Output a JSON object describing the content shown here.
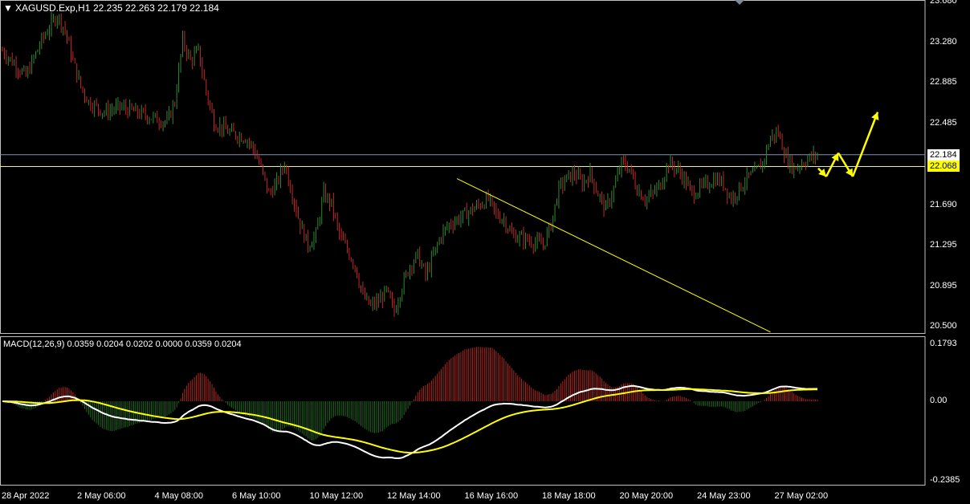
{
  "header": {
    "symbol": "XAGUSD.Exp,H1",
    "ohlc": "22.235 22.263 22.179 22.184",
    "macd_label": "MACD(12,26,9) 0.0359 0.0204 0.0202 0.0000 0.0359 0.0204"
  },
  "colors": {
    "background": "#000000",
    "bull": "#2e8b2e",
    "bear": "#c62828",
    "hist_pos": "#b3261e",
    "hist_neg": "#1f6b1f",
    "macd_line": "#ffffff",
    "signal_line": "#ffff00",
    "resistance": "#ffff00",
    "current_price_line": "#8096b0",
    "frame": "#c0c0c0"
  },
  "icons": [
    "dropdown-triangle-icon",
    "arrow-up-icon"
  ],
  "chart_data": [
    {
      "type": "candlestick",
      "symbol": "XAGUSD.Exp",
      "timeframe": "H1",
      "y_ticks": [
        "23.680",
        "23.280",
        "22.885",
        "22.485",
        "22.184",
        "22.068",
        "21.690",
        "21.295",
        "20.895",
        "20.500"
      ],
      "ylim": [
        20.44,
        23.68
      ],
      "x_ticks": [
        "28 Apr 2022",
        "2 May 06:00",
        "4 May 08:00",
        "6 May 10:00",
        "10 May 12:00",
        "12 May 14:00",
        "16 May 16:00",
        "18 May 18:00",
        "20 May 20:00",
        "24 May 23:00",
        "27 May 02:00"
      ],
      "current_price": "22.184",
      "resistance_level": "22.068",
      "close_path": [
        [
          0,
          23.2
        ],
        [
          3,
          22.95
        ],
        [
          5,
          23.3
        ],
        [
          7,
          23.55
        ],
        [
          8,
          23.4
        ],
        [
          9,
          23.1
        ],
        [
          10,
          22.85
        ],
        [
          11,
          22.7
        ],
        [
          13,
          22.6
        ],
        [
          15,
          22.65
        ],
        [
          17,
          22.6
        ],
        [
          19,
          22.55
        ],
        [
          21,
          22.5
        ],
        [
          22,
          22.7
        ],
        [
          23,
          23.3
        ],
        [
          24,
          23.1
        ],
        [
          25,
          23.2
        ],
        [
          26,
          22.8
        ],
        [
          27,
          22.5
        ],
        [
          29,
          22.4
        ],
        [
          31,
          22.35
        ],
        [
          32,
          22.25
        ],
        [
          33,
          22.05
        ],
        [
          34,
          21.8
        ],
        [
          35,
          21.9
        ],
        [
          36,
          22.1
        ],
        [
          37,
          21.8
        ],
        [
          38,
          21.5
        ],
        [
          39,
          21.3
        ],
        [
          40,
          21.4
        ],
        [
          41,
          21.8
        ],
        [
          42,
          21.7
        ],
        [
          43,
          21.4
        ],
        [
          45,
          21.1
        ],
        [
          46,
          20.8
        ],
        [
          47,
          20.7
        ],
        [
          48,
          20.75
        ],
        [
          49,
          20.85
        ],
        [
          50,
          20.65
        ],
        [
          51,
          20.9
        ],
        [
          52,
          21.1
        ],
        [
          53,
          21.2
        ],
        [
          54,
          21.0
        ],
        [
          55,
          21.2
        ],
        [
          56,
          21.4
        ],
        [
          57,
          21.5
        ],
        [
          58,
          21.55
        ],
        [
          59,
          21.6
        ],
        [
          60,
          21.65
        ],
        [
          61,
          21.7
        ],
        [
          62,
          21.75
        ],
        [
          63,
          21.6
        ],
        [
          64,
          21.55
        ],
        [
          65,
          21.4
        ],
        [
          67,
          21.35
        ],
        [
          69,
          21.3
        ],
        [
          70,
          21.5
        ],
        [
          71,
          21.85
        ],
        [
          72,
          21.95
        ],
        [
          73,
          22.0
        ],
        [
          74,
          21.9
        ],
        [
          75,
          22.0
        ],
        [
          76,
          21.8
        ],
        [
          77,
          21.65
        ],
        [
          78,
          21.85
        ],
        [
          79,
          22.1
        ],
        [
          80,
          22.05
        ],
        [
          81,
          21.85
        ],
        [
          82,
          21.75
        ],
        [
          83,
          21.8
        ],
        [
          84,
          21.9
        ],
        [
          85,
          22.1
        ],
        [
          86,
          22.05
        ],
        [
          87,
          21.95
        ],
        [
          88,
          21.8
        ],
        [
          89,
          21.85
        ],
        [
          90,
          21.9
        ],
        [
          91,
          21.95
        ],
        [
          92,
          21.9
        ],
        [
          93,
          21.75
        ],
        [
          94,
          21.85
        ],
        [
          95,
          21.95
        ],
        [
          96,
          22.0
        ],
        [
          97,
          22.1
        ],
        [
          98,
          22.35
        ],
        [
          99,
          22.4
        ],
        [
          100,
          22.15
        ],
        [
          101,
          22.05
        ],
        [
          102,
          22.1
        ],
        [
          103,
          22.15
        ],
        [
          104,
          22.18
        ]
      ],
      "forecast_arrows": [
        [
          22.05,
          22.2
        ],
        [
          22.2,
          22.1
        ],
        [
          22.1,
          22.6
        ]
      ]
    },
    {
      "type": "macd",
      "label": "MACD(12,26,9)",
      "y_ticks": [
        "0.1793",
        "0.00",
        "-0.2385"
      ],
      "ylim": [
        -0.2385,
        0.1793
      ]
    }
  ]
}
